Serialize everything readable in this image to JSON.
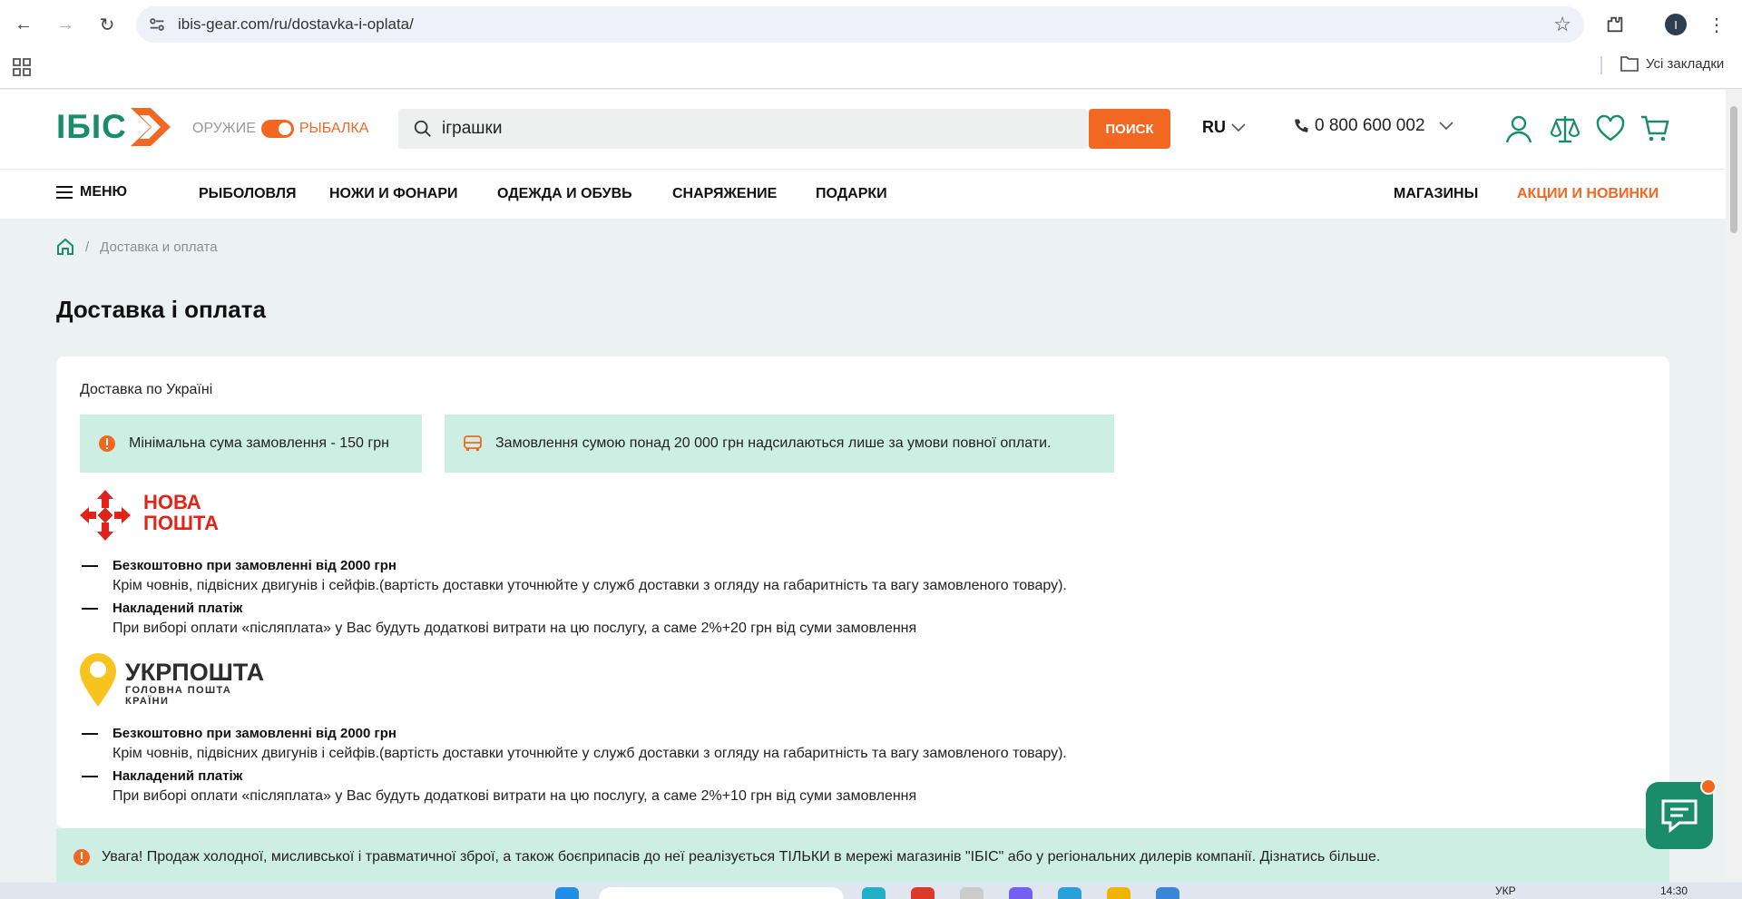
{
  "browser": {
    "url": "ibis-gear.com/ru/dostavka-i-oplata/",
    "profile_initial": "I",
    "bookmarks_label": "Усі закладки"
  },
  "header": {
    "logo_text": "ІБІС",
    "mode_off": "ОРУЖИЕ",
    "mode_on": "РЫБАЛКА",
    "search_value": "іграшки",
    "search_button": "ПОИСК",
    "lang": "RU",
    "phone": "0 800 600 002"
  },
  "nav": {
    "menu": "МЕНЮ",
    "items": [
      "РЫБОЛОВЛЯ",
      "НОЖИ И ФОНАРИ",
      "ОДЕЖДА И ОБУВЬ",
      "СНАРЯЖЕНИЕ",
      "ПОДАРКИ"
    ],
    "stores": "МАГАЗИНЫ",
    "promo": "АКЦИИ И НОВИНКИ"
  },
  "breadcrumb": {
    "current": "Доставка и оплата"
  },
  "page_title": "Доставка і оплата",
  "delivery": {
    "section_title": "Доставка по Україні",
    "note_min": "Мінімальна сума замовлення - 150 грн",
    "note_full_payment": "Замовлення сумою понад 20 000 грн надсилаються лише за умови повної оплати.",
    "nova": {
      "logo_line1": "НОВА",
      "logo_line2": "ПОШТА",
      "free_title": "Безкоштовно при замовленні від 2000 грн",
      "free_desc": "Крім човнів, підвісних двигунів і сейфів.(вартість доставки уточнюйте у служб доставки з огляду на габаритність та вагу замовленого товару).",
      "cod_title": "Накладений платіж",
      "cod_desc": "При виборі оплати «післяплата» у Вас будуть додаткові витрати на цю послугу, а саме 2%+20 грн від суми замовлення"
    },
    "ukr": {
      "logo_line1": "УКРПОШТА",
      "logo_line2": "ГОЛОВНА ПОШТА КРАЇНИ",
      "free_title": "Безкоштовно при замовленні від 2000 грн",
      "free_desc": "Крім човнів, підвісних двигунів і сейфів.(вартість доставки уточнюйте у служб доставки з огляду на габаритність та вагу замовленого товару).",
      "cod_title": "Накладений платіж",
      "cod_desc": "При виборі оплати «післяплата» у Вас будуть додаткові витрати на цю послугу, а саме 2%+10 грн від суми замовлення"
    }
  },
  "warning": "Увага! Продаж холодної, мисливської і травматичної зброї, а також боєприпасів до неї реалізується ТІЛЬКИ в мережі магазинів \"ІБІС\" або у регіональних дилерів компанії. Дізнатись більше.",
  "taskbar": {
    "lang": "УКР",
    "time": "14:30"
  },
  "colors": {
    "brand_green": "#1a8c69",
    "accent_orange": "#f26722",
    "note_bg": "#cdeee3",
    "nova_red": "#e2231a",
    "ukr_yellow": "#f9c31f"
  }
}
